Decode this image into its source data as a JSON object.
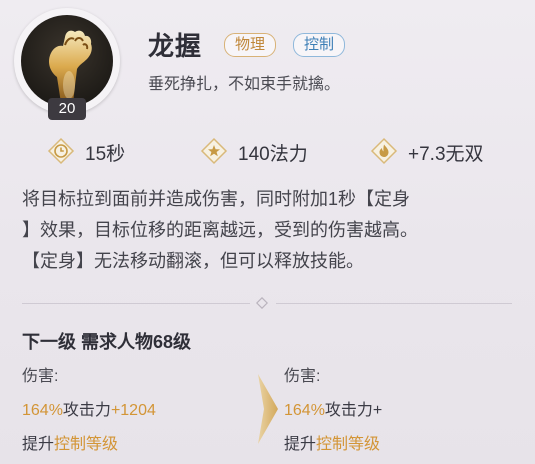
{
  "skill": {
    "name": "龙握",
    "level": "20",
    "tags": [
      "物理",
      "控制"
    ],
    "subtitle": "垂死挣扎，不如束手就擒。",
    "icon": "golden-dragon-claw-icon"
  },
  "stats": [
    {
      "icon": "clock-icon",
      "text": "15秒"
    },
    {
      "icon": "star-icon",
      "text": "140法力"
    },
    {
      "icon": "flame-icon",
      "text": "+7.3无双"
    }
  ],
  "description": {
    "line1": "将目标拉到面前并造成伤害，同时附加1秒【定身",
    "line2": "】效果，目标位移的距离越远，受到的伤害越高。",
    "line3": "【定身】无法移动翻滚，但可以释放技能。"
  },
  "next_level": {
    "title": "下一级 需求人物68级",
    "left": {
      "damage_label": "伤害:",
      "damage_pct": "164%",
      "damage_mid": "攻击力",
      "damage_bonus": "+1204",
      "upgrade_prefix": "提升",
      "upgrade_highlight": "控制等级"
    },
    "right": {
      "damage_label": "伤害:",
      "damage_pct": "164%",
      "damage_mid": "攻击力+",
      "upgrade_prefix": "提升",
      "upgrade_highlight": "控制等级"
    }
  },
  "colors": {
    "accent_orange": "#d39536",
    "tag_physical": "#c0883a",
    "tag_control": "#3e7fb6"
  }
}
